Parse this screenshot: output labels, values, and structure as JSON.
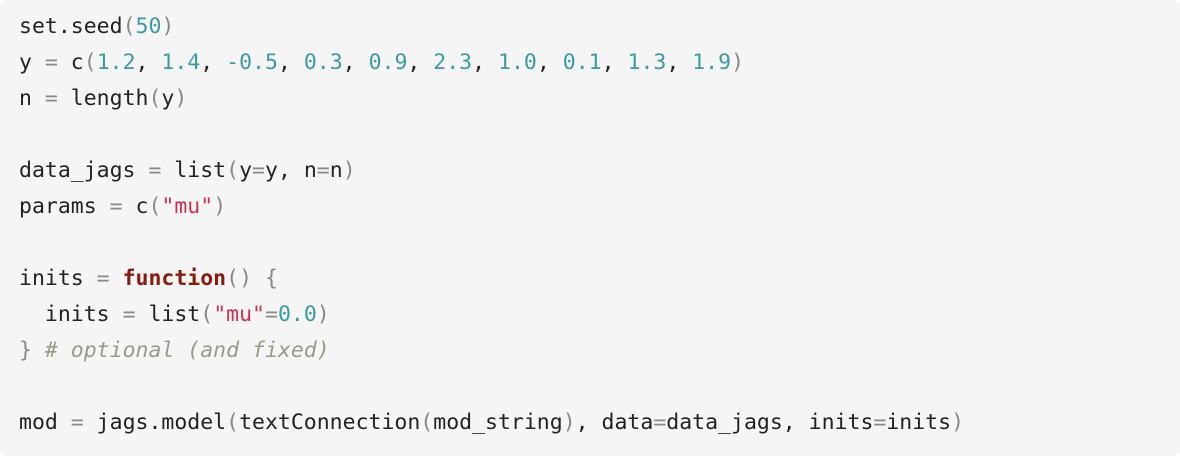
{
  "code": {
    "language": "r",
    "lines": [
      [
        [
          "plain",
          "set.seed"
        ],
        [
          "punct",
          "("
        ],
        [
          "num",
          "50"
        ],
        [
          "punct",
          ")"
        ]
      ],
      [
        [
          "plain",
          "y "
        ],
        [
          "punct",
          "="
        ],
        [
          "plain",
          " c"
        ],
        [
          "punct",
          "("
        ],
        [
          "num",
          "1.2"
        ],
        [
          "plain",
          ", "
        ],
        [
          "num",
          "1.4"
        ],
        [
          "plain",
          ", "
        ],
        [
          "num",
          "-0.5"
        ],
        [
          "plain",
          ", "
        ],
        [
          "num",
          "0.3"
        ],
        [
          "plain",
          ", "
        ],
        [
          "num",
          "0.9"
        ],
        [
          "plain",
          ", "
        ],
        [
          "num",
          "2.3"
        ],
        [
          "plain",
          ", "
        ],
        [
          "num",
          "1.0"
        ],
        [
          "plain",
          ", "
        ],
        [
          "num",
          "0.1"
        ],
        [
          "plain",
          ", "
        ],
        [
          "num",
          "1.3"
        ],
        [
          "plain",
          ", "
        ],
        [
          "num",
          "1.9"
        ],
        [
          "punct",
          ")"
        ]
      ],
      [
        [
          "plain",
          "n "
        ],
        [
          "punct",
          "="
        ],
        [
          "plain",
          " length"
        ],
        [
          "punct",
          "("
        ],
        [
          "plain",
          "y"
        ],
        [
          "punct",
          ")"
        ]
      ],
      [],
      [
        [
          "plain",
          "data_jags "
        ],
        [
          "punct",
          "="
        ],
        [
          "plain",
          " list"
        ],
        [
          "punct",
          "("
        ],
        [
          "plain",
          "y"
        ],
        [
          "punct",
          "="
        ],
        [
          "plain",
          "y, n"
        ],
        [
          "punct",
          "="
        ],
        [
          "plain",
          "n"
        ],
        [
          "punct",
          ")"
        ]
      ],
      [
        [
          "plain",
          "params "
        ],
        [
          "punct",
          "="
        ],
        [
          "plain",
          " c"
        ],
        [
          "punct",
          "("
        ],
        [
          "str",
          "\"mu\""
        ],
        [
          "punct",
          ")"
        ]
      ],
      [],
      [
        [
          "plain",
          "inits "
        ],
        [
          "punct",
          "="
        ],
        [
          "plain",
          " "
        ],
        [
          "kw",
          "function"
        ],
        [
          "punct",
          "()"
        ],
        [
          "plain",
          " "
        ],
        [
          "punct",
          "{"
        ]
      ],
      [
        [
          "plain",
          "  inits "
        ],
        [
          "punct",
          "="
        ],
        [
          "plain",
          " list"
        ],
        [
          "punct",
          "("
        ],
        [
          "str",
          "\"mu\""
        ],
        [
          "punct",
          "="
        ],
        [
          "num",
          "0.0"
        ],
        [
          "punct",
          ")"
        ]
      ],
      [
        [
          "punct",
          "}"
        ],
        [
          "plain",
          " "
        ],
        [
          "comment",
          "# optional (and fixed)"
        ]
      ],
      [],
      [
        [
          "plain",
          "mod "
        ],
        [
          "punct",
          "="
        ],
        [
          "plain",
          " jags.model"
        ],
        [
          "punct",
          "("
        ],
        [
          "plain",
          "textConnection"
        ],
        [
          "punct",
          "("
        ],
        [
          "plain",
          "mod_string"
        ],
        [
          "punct",
          ")"
        ],
        [
          "plain",
          ", data"
        ],
        [
          "punct",
          "="
        ],
        [
          "plain",
          "data_jags, inits"
        ],
        [
          "punct",
          "="
        ],
        [
          "plain",
          "inits"
        ],
        [
          "punct",
          ")"
        ]
      ]
    ]
  }
}
